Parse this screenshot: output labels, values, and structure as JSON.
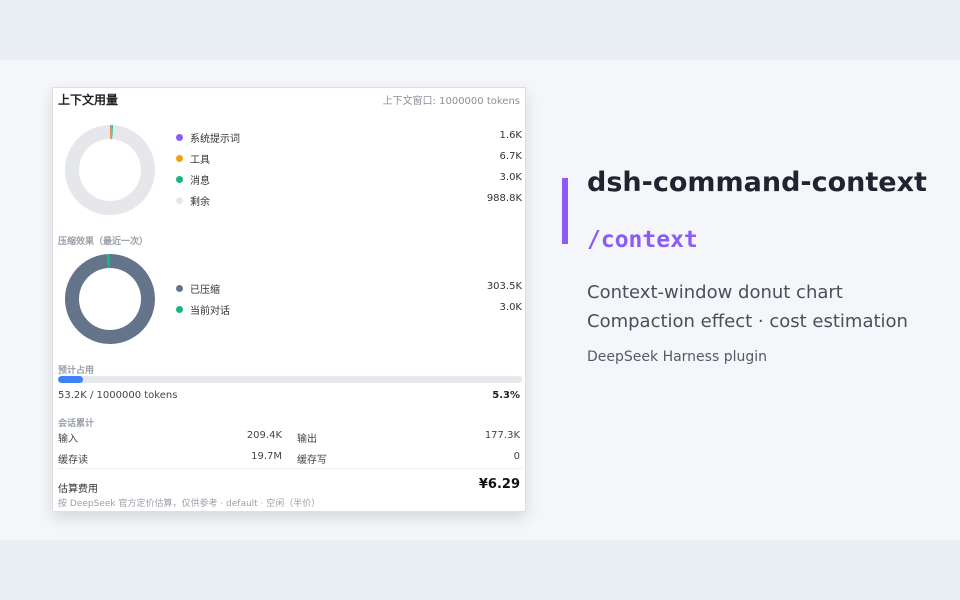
{
  "panel": {
    "title": "上下文用量",
    "context_window": "上下文窗口: 1000000 tokens",
    "usage_legend": [
      {
        "label": "系统提示词",
        "value": "1.6K",
        "color": "#8b5cf6"
      },
      {
        "label": "工具",
        "value": "6.7K",
        "color": "#f59e0b"
      },
      {
        "label": "消息",
        "value": "3.0K",
        "color": "#10b981"
      },
      {
        "label": "剩余",
        "value": "988.8K",
        "color": "#e5e7eb"
      }
    ],
    "compaction": {
      "label": "压缩效果（最近一次）",
      "legend": [
        {
          "label": "已压缩",
          "value": "303.5K",
          "color": "#64748b"
        },
        {
          "label": "当前对话",
          "value": "3.0K",
          "color": "#10b981"
        }
      ]
    },
    "projected": {
      "label": "预计占用",
      "fraction": 0.053,
      "tokens_text": "53.2K / 1000000 tokens",
      "percent_text": "5.3%",
      "color": "#3b82f6"
    },
    "session": {
      "label": "会话累计",
      "input_label": "输入",
      "input_value": "209.4K",
      "output_label": "输出",
      "output_value": "177.3K",
      "cache_read_label": "缓存读",
      "cache_read_value": "19.7M",
      "cache_write_label": "缓存写",
      "cache_write_value": "0"
    },
    "cost": {
      "label": "估算费用",
      "value": "¥6.29",
      "note": "按 DeepSeek 官方定价估算，仅供参考 · default · 空闲（半价）"
    }
  },
  "chart_data": [
    {
      "type": "pie",
      "categories": [
        "系统提示词",
        "工具",
        "消息",
        "剩余"
      ],
      "values": [
        1.6,
        6.7,
        3.0,
        988.8
      ],
      "colors": [
        "#8b5cf6",
        "#f59e0b",
        "#10b981",
        "#e5e7eb"
      ]
    },
    {
      "type": "pie",
      "categories": [
        "已压缩",
        "当前对话"
      ],
      "values": [
        303.5,
        3.0
      ],
      "colors": [
        "#64748b",
        "#10b981"
      ]
    }
  ],
  "hero": {
    "title": "dsh-command-context",
    "command": "/context",
    "desc_line1": "Context-window donut chart",
    "desc_line2": "Compaction effect · cost estimation",
    "subtitle": "DeepSeek Harness plugin",
    "accent_color": "#8b5cf6"
  }
}
